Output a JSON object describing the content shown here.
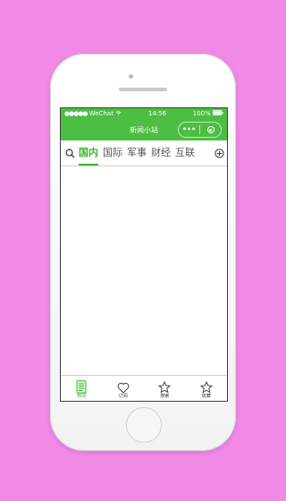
{
  "status_bar": {
    "signal": "●●●●●",
    "carrier": "WeChat",
    "time": "14:56",
    "battery": "100%"
  },
  "nav": {
    "title": "新闻小站",
    "more_icon": "more-dots-icon",
    "close_icon": "target-icon"
  },
  "tabs": {
    "search_icon": "search-icon",
    "add_icon": "add-circle-icon",
    "items": [
      {
        "label": "国内",
        "active": true
      },
      {
        "label": "国际",
        "active": false
      },
      {
        "label": "军事",
        "active": false
      },
      {
        "label": "财经",
        "active": false
      },
      {
        "label": "互联",
        "active": false
      }
    ]
  },
  "tabbar": {
    "items": [
      {
        "label": "新闻",
        "icon": "document-icon",
        "active": true
      },
      {
        "label": "订阅",
        "icon": "heart-icon",
        "active": false
      },
      {
        "label": "搜索",
        "icon": "star-icon",
        "active": false
      },
      {
        "label": "收藏",
        "icon": "star-icon",
        "active": false
      }
    ]
  },
  "colors": {
    "brand": "#4cbe43",
    "active": "#35b82c",
    "background": "#f08ae6"
  }
}
